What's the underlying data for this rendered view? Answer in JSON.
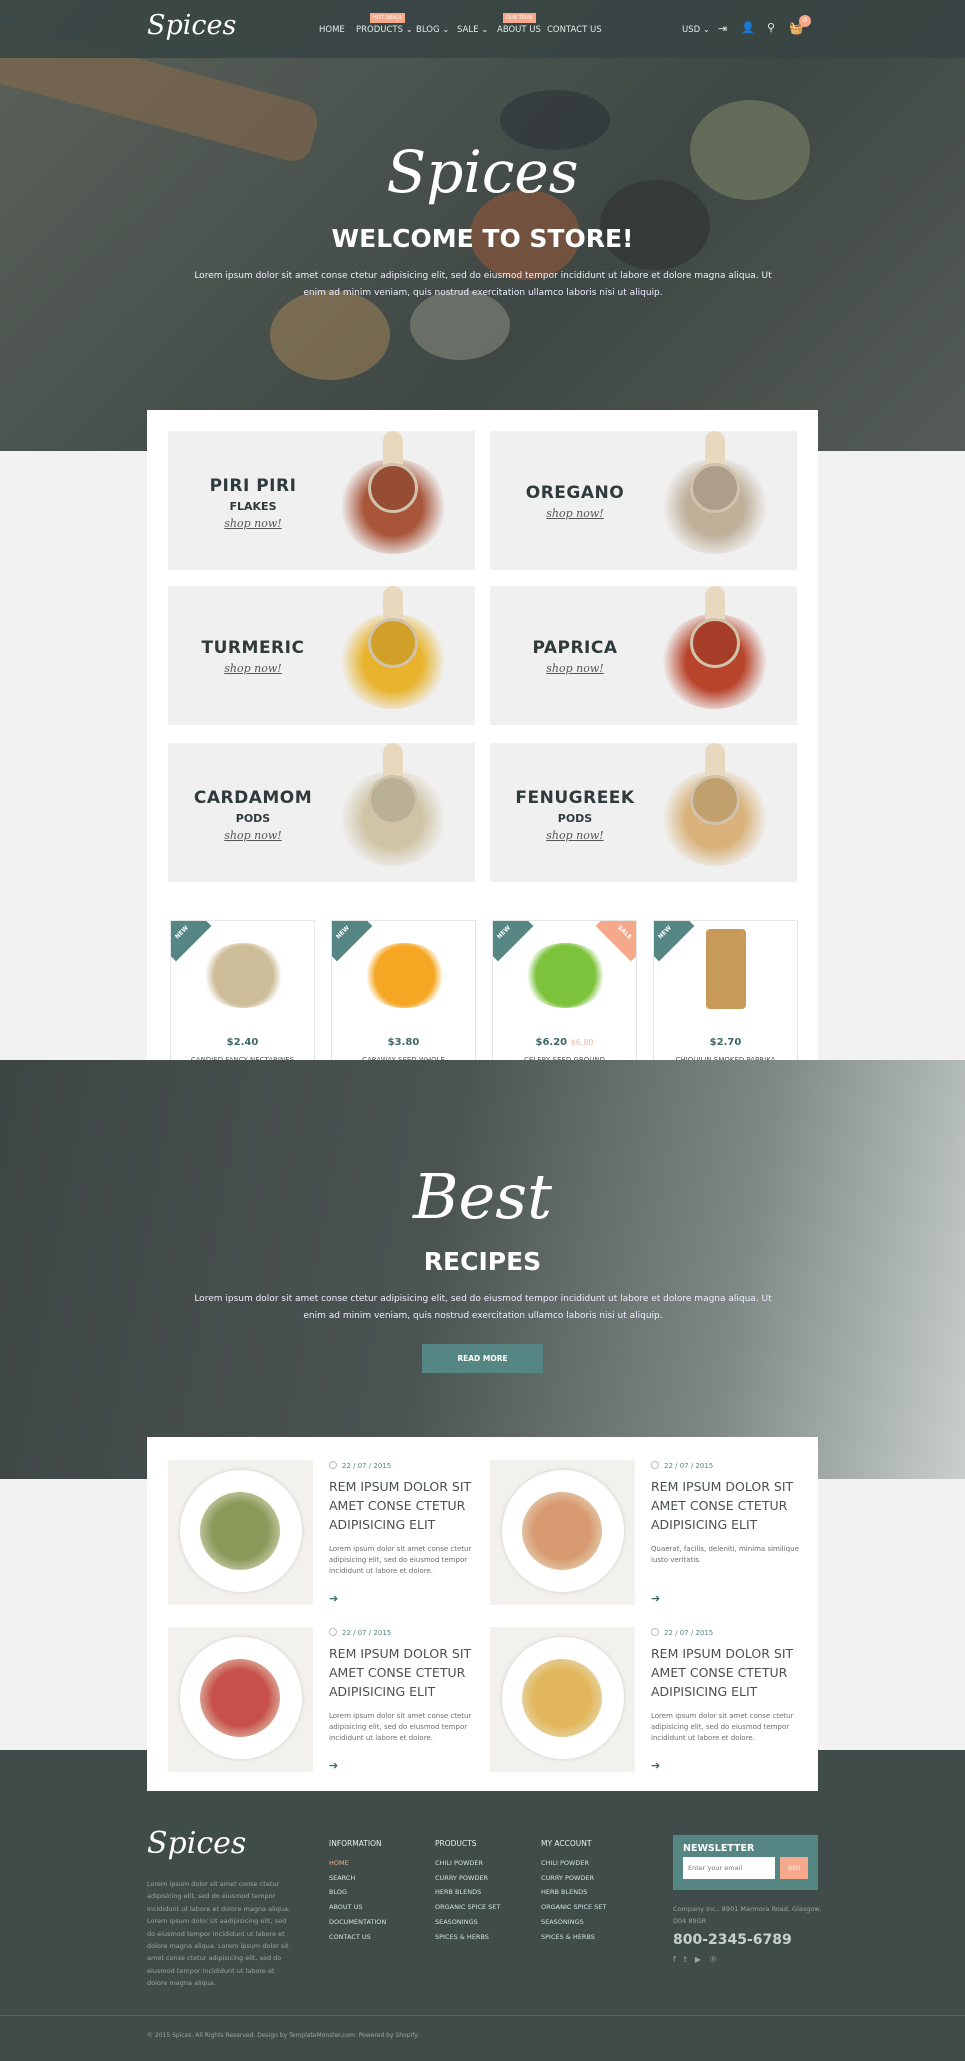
{
  "colors": {
    "accent": "#558684",
    "sale": "#f6a88a",
    "dark": "#3f4c4a"
  },
  "header": {
    "logo": "Spices",
    "nav": [
      {
        "label": "HOME"
      },
      {
        "label": "PRODUCTS",
        "badge": "HOT DEALS",
        "dropdown": true
      },
      {
        "label": "BLOG",
        "dropdown": true
      },
      {
        "label": "SALE",
        "dropdown": true
      },
      {
        "label": "ABOUT US",
        "badge": "OUR TEAM"
      },
      {
        "label": "CONTACT US"
      }
    ],
    "currency": "USD",
    "cart_count": "0",
    "icons": [
      "login-icon",
      "user-add-icon",
      "search-icon",
      "cart-icon"
    ]
  },
  "hero": {
    "script": "Spices",
    "title": "WELCOME TO STORE!",
    "text": "Lorem ipsum dolor sit amet conse ctetur adipisicing elit, sed do eiusmod tempor incididunt ut labore et dolore magna aliqua. Ut enim ad minim veniam, quis nostrud exercitation ullamco laboris nisi ut aliquip."
  },
  "categories": [
    {
      "name": "PIRI PIRI",
      "sub": "FLAKES",
      "link": "shop now!",
      "color": "#a8553a"
    },
    {
      "name": "OREGANO",
      "sub": "",
      "link": "shop now!",
      "color": "#bfb09a"
    },
    {
      "name": "TURMERIC",
      "sub": "",
      "link": "shop now!",
      "color": "#e8b22c"
    },
    {
      "name": "PAPRICA",
      "sub": "",
      "link": "shop now!",
      "color": "#b8442c"
    },
    {
      "name": "CARDAMOM",
      "sub": "PODS",
      "link": "shop now!",
      "color": "#cfc4a6"
    },
    {
      "name": "FENUGREEK",
      "sub": "PODS",
      "link": "shop now!",
      "color": "#d8b27a"
    }
  ],
  "products": [
    {
      "badge": "NEW",
      "price": "$2.40",
      "name": "CANDIED FANCY NECTARINES",
      "color": "#cdbd98"
    },
    {
      "badge": "NEW",
      "price": "$3.80",
      "name": "CARAWAY SEED WHOLE",
      "color": "#f5a623"
    },
    {
      "badge": "NEW",
      "sale": "SALE",
      "price": "$6.20",
      "old_price": "$6.80",
      "name": "CELERY SEED GROUND",
      "color": "#7cc23a"
    },
    {
      "badge": "NEW",
      "price": "$2.70",
      "name": "CHIQUILIN SMOKED PAPRIKA",
      "color": "#c79a5a"
    }
  ],
  "recipes": {
    "script": "Best",
    "title": "RECIPES",
    "text": "Lorem ipsum dolor sit amet conse ctetur adipisicing elit, sed do eiusmod tempor incididunt ut labore et dolore magna aliqua. Ut enim ad minim veniam, quis nostrud exercitation ullamco laboris nisi ut aliquip.",
    "button": "READ MORE"
  },
  "posts": [
    {
      "date": "22 / 07 / 2015",
      "title": "REM IPSUM DOLOR SIT AMET CONSE CTETUR ADIPISICING ELIT",
      "excerpt": "Lorem ipsum dolor sit amet conse ctetur adipisicing elit, sed do eiusmod tempor incididunt ut labore et dolore.",
      "color": "#8a9a5a"
    },
    {
      "date": "22 / 07 / 2015",
      "title": "REM IPSUM DOLOR SIT AMET CONSE CTETUR ADIPISICING ELIT",
      "excerpt": "Quaerat, facilis, deleniti, minima similique iusto veritatis.",
      "color": "#d89a70"
    },
    {
      "date": "22 / 07 / 2015",
      "title": "REM IPSUM DOLOR SIT AMET CONSE CTETUR ADIPISICING ELIT",
      "excerpt": "Lorem ipsum dolor sit amet conse ctetur adipisicing elit, sed do eiusmod tempor incididunt ut labore et dolore.",
      "color": "#c7504a"
    },
    {
      "date": "22 / 07 / 2015",
      "title": "REM IPSUM DOLOR SIT AMET CONSE CTETUR ADIPISICING ELIT",
      "excerpt": "Lorem ipsum dolor sit amet conse ctetur adipisicing elit, sed do eiusmod tempor incididunt ut labore et dolore.",
      "color": "#e2b65a"
    }
  ],
  "footer": {
    "logo": "Spices",
    "about": "Lorem ipsum dolor sit amet conse ctetur adipisicing elit, sed do eiusmod tempor incididunt ut labore et dolore magna aliqua. Lorem ipsum dolor sit aadipisicing elit, sed do eiusmod tempor incididunt ut labore et dolore magna aliqua. Lorem ipsum dolor sit amet conse ctetur adipisicing elit, sed do eiusmod tempor incididunt ut labore et dolore magna aliqua.",
    "columns": [
      {
        "title": "INFORMATION",
        "items": [
          "HOME",
          "SEARCH",
          "BLOG",
          "ABOUT US",
          "DOCUMENTATION",
          "CONTACT US"
        ]
      },
      {
        "title": "PRODUCTS",
        "items": [
          "CHILI POWDER",
          "CURRY POWDER",
          "HERB BLENDS",
          "ORGANIC SPICE SET",
          "SEASONINGS",
          "SPICES & HERBS"
        ]
      },
      {
        "title": "MY ACCOUNT",
        "items": [
          "CHILI POWDER",
          "CURRY POWDER",
          "HERB BLENDS",
          "ORGANIC SPICE SET",
          "SEASONINGS",
          "SPICES & HERBS"
        ]
      }
    ],
    "newsletter": {
      "title": "NEWSLETTER",
      "placeholder": "Enter your email",
      "button": "GO!"
    },
    "address": "Company Inc., 8901 Marmora Road, Glasgow, D04 89GR",
    "phone": "800-2345-6789",
    "social": [
      "facebook-icon",
      "twitter-icon",
      "youtube-icon",
      "pinterest-icon"
    ],
    "copyright": "© 2015 Spices. All Rights Reserved. Design by TemplateMonster.com. Powered by Shopify."
  }
}
